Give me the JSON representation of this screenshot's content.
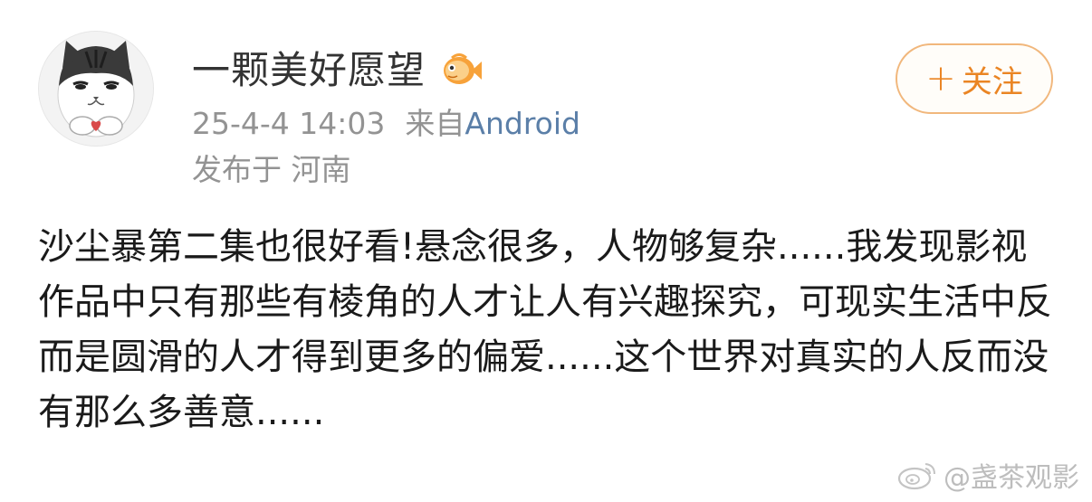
{
  "post": {
    "user": {
      "name": "一颗美好愿望",
      "avatar_icon": "cat-avatar-icon",
      "badge_icon": "fish-vip-icon"
    },
    "meta": {
      "date": "25-4-4 14:03",
      "from_label": "来自",
      "source": "Android",
      "location": "发布于 河南"
    },
    "follow": {
      "plus": "+",
      "label": "关注"
    },
    "content": "沙尘暴第二集也很好看!悬念很多，人物够复杂......我发现影视作品中只有那些有棱角的人才让人有兴趣探究，可现实生活中反而是圆滑的人才得到更多的偏爱......这个世界对真实的人反而没有那么多善意......",
    "watermark": "@盏茶观影"
  },
  "colors": {
    "accent": "#ea8524",
    "link": "#5b7fa8",
    "meta_text": "#939393"
  }
}
